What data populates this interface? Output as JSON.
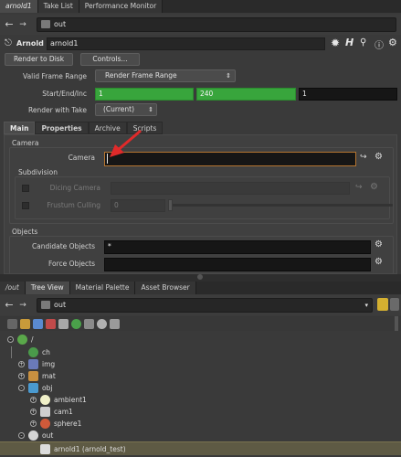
{
  "top_tabs": [
    "arnold1",
    "Take List",
    "Performance Monitor"
  ],
  "top_path": "out",
  "node": {
    "type_label": "Arnold",
    "name": "arnold1",
    "header_icons": [
      "gear-icon",
      "help-h-icon",
      "question-icon",
      "info-icon",
      "settings-icon"
    ]
  },
  "buttons": {
    "render_to_disk": "Render to Disk",
    "controls": "Controls..."
  },
  "params": {
    "valid_frame_range_label": "Valid Frame Range",
    "valid_frame_range_value": "Render Frame Range",
    "start_end_inc_label": "Start/End/Inc",
    "start": "1",
    "end": "240",
    "inc": "1",
    "render_with_take_label": "Render with Take",
    "render_with_take_value": "(Current)"
  },
  "param_tabs": [
    "Main",
    "Properties",
    "Archive",
    "Scripts"
  ],
  "camera_section": {
    "title": "Camera",
    "camera_label": "Camera",
    "camera_value": "",
    "subdivision_title": "Subdivision",
    "dicing_camera_label": "Dicing Camera",
    "frustum_culling_label": "Frustum Culling",
    "frustum_value": "0"
  },
  "objects_section": {
    "title": "Objects",
    "candidate_label": "Candidate Objects",
    "candidate_value": "*",
    "force_label": "Force Objects",
    "force_value": ""
  },
  "bottom_tabs": [
    "/out",
    "Tree View",
    "Material Palette",
    "Asset Browser"
  ],
  "bottom_path": "out",
  "tree": [
    {
      "label": "/",
      "depth": 0,
      "icon": "root-icon"
    },
    {
      "label": "ch",
      "depth": 1,
      "icon": "ch-icon"
    },
    {
      "label": "img",
      "depth": 1,
      "icon": "img-icon"
    },
    {
      "label": "mat",
      "depth": 1,
      "icon": "mat-icon"
    },
    {
      "label": "obj",
      "depth": 1,
      "icon": "obj-icon"
    },
    {
      "label": "ambient1",
      "depth": 2,
      "icon": "light-icon"
    },
    {
      "label": "cam1",
      "depth": 2,
      "icon": "camera-icon"
    },
    {
      "label": "sphere1",
      "depth": 2,
      "icon": "sphere-icon"
    },
    {
      "label": "out",
      "depth": 1,
      "icon": "out-icon"
    },
    {
      "label": "arnold1 (arnold_test)",
      "depth": 2,
      "icon": "rop-icon"
    }
  ]
}
